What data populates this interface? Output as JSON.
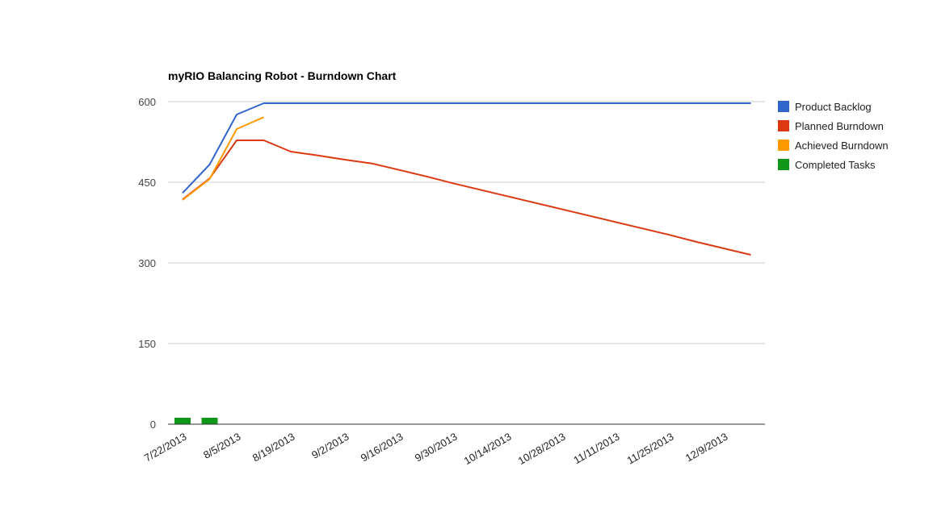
{
  "chart_data": {
    "type": "line",
    "title": "myRIO Balancing Robot - Burndown Chart",
    "xlabel": "",
    "ylabel": "",
    "ylim": [
      0,
      600
    ],
    "yticks": [
      0,
      150,
      300,
      450,
      600
    ],
    "grid": true,
    "legend_position": "right",
    "categories": [
      "7/22/2013",
      "7/29/2013",
      "8/5/2013",
      "8/12/2013",
      "8/19/2013",
      "8/26/2013",
      "9/2/2013",
      "9/9/2013",
      "9/16/2013",
      "9/23/2013",
      "9/30/2013",
      "10/7/2013",
      "10/14/2013",
      "10/21/2013",
      "10/28/2013",
      "11/4/2013",
      "11/11/2013",
      "11/18/2013",
      "11/25/2013",
      "12/2/2013",
      "12/9/2013",
      "12/16/2013"
    ],
    "xtick_labels": [
      "7/22/2013",
      "8/5/2013",
      "8/19/2013",
      "9/2/2013",
      "9/16/2013",
      "9/30/2013",
      "10/14/2013",
      "10/28/2013",
      "11/11/2013",
      "11/25/2013",
      "12/9/2013"
    ],
    "series": [
      {
        "name": "Product Backlog",
        "kind": "line",
        "color": "#3366cc",
        "values": [
          430,
          483,
          576,
          597,
          597,
          597,
          597,
          597,
          597,
          597,
          597,
          597,
          597,
          597,
          597,
          597,
          597,
          597,
          597,
          597,
          597,
          597
        ]
      },
      {
        "name": "Planned Burndown",
        "kind": "line",
        "color": "#dc3912",
        "values": [
          418,
          457,
          528,
          528,
          507,
          500,
          492,
          485,
          473,
          461,
          448,
          436,
          424,
          412,
          400,
          388,
          376,
          364,
          352,
          339,
          327,
          315
        ]
      },
      {
        "name": "Achieved Burndown",
        "kind": "line",
        "color": "#ff9900",
        "values": [
          417,
          456,
          549,
          571,
          null,
          null,
          null,
          null,
          null,
          null,
          null,
          null,
          null,
          null,
          null,
          null,
          null,
          null,
          null,
          null,
          null,
          null
        ]
      },
      {
        "name": "Completed Tasks",
        "kind": "bar",
        "color": "#109618",
        "values": [
          12,
          12,
          0,
          0,
          0,
          0,
          0,
          0,
          0,
          0,
          0,
          0,
          0,
          0,
          0,
          0,
          0,
          0,
          0,
          0,
          0,
          0
        ]
      }
    ]
  }
}
